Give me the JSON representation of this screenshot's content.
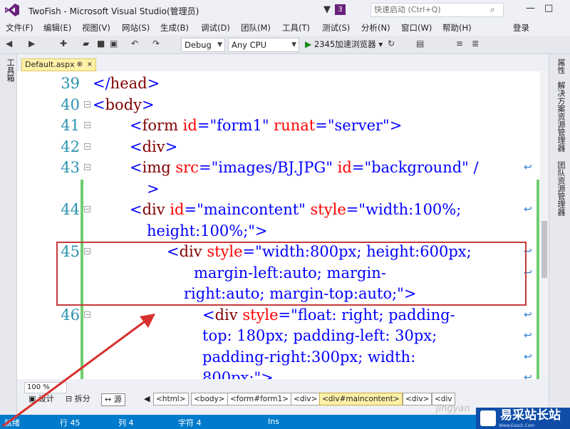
{
  "window": {
    "title": "TwoFish - Microsoft Visual Studio(管理员)",
    "notification_count": "3",
    "quick_launch_placeholder": "快速启动 (Ctrl+Q)"
  },
  "menu": [
    "文件(F)",
    "编辑(E)",
    "视图(V)",
    "网站(S)",
    "生成(B)",
    "调试(D)",
    "团队(M)",
    "工具(T)",
    "测试(S)",
    "分析(N)",
    "窗口(W)",
    "帮助(H)"
  ],
  "signin": "登录",
  "toolbar": {
    "config": "Debug",
    "platform": "Any CPU",
    "browser": "2345加速浏览器"
  },
  "left_panel": "工具箱",
  "right_panels": [
    "属性",
    "解决方案资源管理器",
    "团队资源管理器"
  ],
  "tab": {
    "name": "Default.aspx",
    "pin": "⊕",
    "close": "×"
  },
  "lines": [
    {
      "num": "39",
      "parts": [
        [
          "br",
          "</"
        ],
        [
          "tag",
          "head"
        ],
        [
          "br",
          ">"
        ]
      ]
    },
    {
      "num": "40",
      "parts": [
        [
          "br",
          "<"
        ],
        [
          "tag",
          "body"
        ],
        [
          "br",
          ">"
        ]
      ]
    },
    {
      "num": "41",
      "parts": [
        [
          "br",
          "<"
        ],
        [
          "tag",
          "form"
        ],
        [
          "at",
          " id"
        ],
        [
          "br",
          "="
        ],
        [
          "vl",
          "\"form1\""
        ],
        [
          "at",
          " runat"
        ],
        [
          "br",
          "="
        ],
        [
          "vl",
          "\"server\""
        ],
        [
          "br",
          ">"
        ]
      ]
    },
    {
      "num": "42",
      "parts": [
        [
          "br",
          "<"
        ],
        [
          "tag",
          "div"
        ],
        [
          "br",
          ">"
        ]
      ]
    },
    {
      "num": "43",
      "parts": [
        [
          "br",
          "<"
        ],
        [
          "tag",
          "img"
        ],
        [
          "at",
          " src"
        ],
        [
          "br",
          "="
        ],
        [
          "vl",
          "\"images/BJ.JPG\""
        ],
        [
          "at",
          " id"
        ],
        [
          "br",
          "="
        ],
        [
          "vl",
          "\"background\""
        ],
        [
          "br",
          " /"
        ]
      ]
    },
    {
      "num": "",
      "parts": [
        [
          "br",
          ">"
        ]
      ]
    },
    {
      "num": "44",
      "parts": [
        [
          "br",
          "<"
        ],
        [
          "tag",
          "div"
        ],
        [
          "at",
          " id"
        ],
        [
          "br",
          "="
        ],
        [
          "vl",
          "\"maincontent\""
        ],
        [
          "at",
          " style"
        ],
        [
          "br",
          "="
        ],
        [
          "vl",
          "\"width:100%;"
        ]
      ]
    },
    {
      "num": "",
      "parts": [
        [
          "vl",
          "height:100%;\""
        ],
        [
          "br",
          ">"
        ]
      ]
    },
    {
      "num": "45",
      "parts": [
        [
          "br",
          "<"
        ],
        [
          "tag",
          "div"
        ],
        [
          "at",
          " style"
        ],
        [
          "br",
          "="
        ],
        [
          "vl",
          "\"width:800px; height:600px;"
        ]
      ]
    },
    {
      "num": "",
      "parts": [
        [
          "vl",
          "margin-left:auto; margin-"
        ]
      ]
    },
    {
      "num": "",
      "parts": [
        [
          "vl",
          "right:auto; margin-top:auto;\""
        ],
        [
          "br",
          ">"
        ]
      ]
    },
    {
      "num": "46",
      "parts": [
        [
          "br",
          "<"
        ],
        [
          "tag",
          "div"
        ],
        [
          "at",
          " style"
        ],
        [
          "br",
          "="
        ],
        [
          "vl",
          "\"float: right; padding-"
        ]
      ]
    },
    {
      "num": "",
      "parts": [
        [
          "vl",
          "top: 180px; padding-left: 30px;"
        ]
      ]
    },
    {
      "num": "",
      "parts": [
        [
          "vl",
          "padding-right:300px; width:"
        ]
      ]
    },
    {
      "num": "",
      "parts": [
        [
          "vl",
          "800px;\""
        ],
        [
          "br",
          ">"
        ]
      ]
    }
  ],
  "zoom": "100 %",
  "views": [
    "设计",
    "拆分",
    "源"
  ],
  "breadcrumbs": [
    "<html>",
    "<body>",
    "<form#form1>",
    "<div>",
    "<div#maincontent>",
    "<div>",
    "<div"
  ],
  "status": {
    "ready": "就绪",
    "row": "行 45",
    "col": "列 4",
    "char": "字符 4",
    "mode": "Ins"
  },
  "watermark": {
    "text": "易采站长站",
    "sub": "Www.Easck.Com",
    "faint": "jingyan"
  }
}
